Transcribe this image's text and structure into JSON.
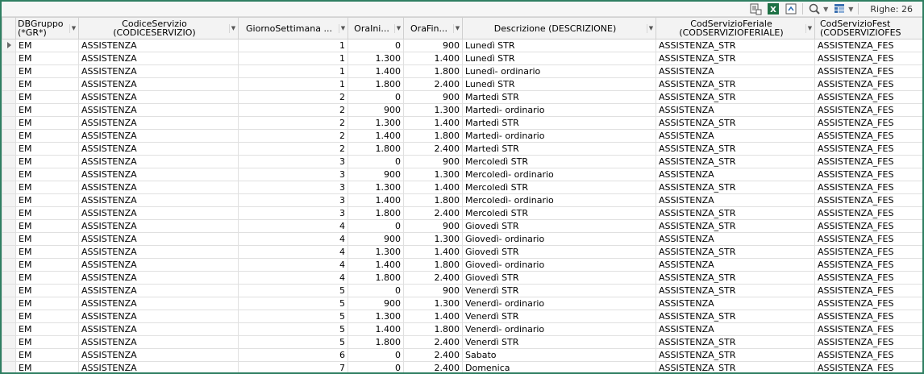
{
  "toolbar": {
    "rows_label": "Righe: 26",
    "icons": [
      "export-icon",
      "excel-icon",
      "refresh-icon",
      "search-icon",
      "filter-icon"
    ]
  },
  "columns": [
    "DBGruppo\n(*GR*)",
    "CodiceServizio\n(CODICESERVIZIO)",
    "GiornoSettimana ...",
    "OraIni...",
    "OraFin...",
    "Descrizione (DESCRIZIONE)",
    "CodServizioFeriale\n(CODSERVIZIOFERIALE)",
    "CodServizioFest\n(CODSERVIZIOFES"
  ],
  "rows": [
    [
      "EM",
      "ASSISTENZA",
      "1",
      "0",
      "900",
      "Lunedì STR",
      "ASSISTENZA_STR",
      "ASSISTENZA_FES"
    ],
    [
      "EM",
      "ASSISTENZA",
      "1",
      "1.300",
      "1.400",
      "Lunedì STR",
      "ASSISTENZA_STR",
      "ASSISTENZA_FES"
    ],
    [
      "EM",
      "ASSISTENZA",
      "1",
      "1.400",
      "1.800",
      "Lunedì- ordinario",
      "ASSISTENZA",
      "ASSISTENZA_FES"
    ],
    [
      "EM",
      "ASSISTENZA",
      "1",
      "1.800",
      "2.400",
      "Lunedì STR",
      "ASSISTENZA_STR",
      "ASSISTENZA_FES"
    ],
    [
      "EM",
      "ASSISTENZA",
      "2",
      "0",
      "900",
      "Martedì STR",
      "ASSISTENZA_STR",
      "ASSISTENZA_FES"
    ],
    [
      "EM",
      "ASSISTENZA",
      "2",
      "900",
      "1.300",
      "Martedì- ordinario",
      "ASSISTENZA",
      "ASSISTENZA_FES"
    ],
    [
      "EM",
      "ASSISTENZA",
      "2",
      "1.300",
      "1.400",
      "Martedì STR",
      "ASSISTENZA_STR",
      "ASSISTENZA_FES"
    ],
    [
      "EM",
      "ASSISTENZA",
      "2",
      "1.400",
      "1.800",
      "Martedì- ordinario",
      "ASSISTENZA",
      "ASSISTENZA_FES"
    ],
    [
      "EM",
      "ASSISTENZA",
      "2",
      "1.800",
      "2.400",
      "Martedì STR",
      "ASSISTENZA_STR",
      "ASSISTENZA_FES"
    ],
    [
      "EM",
      "ASSISTENZA",
      "3",
      "0",
      "900",
      "Mercoledì STR",
      "ASSISTENZA_STR",
      "ASSISTENZA_FES"
    ],
    [
      "EM",
      "ASSISTENZA",
      "3",
      "900",
      "1.300",
      "Mercoledì- ordinario",
      "ASSISTENZA",
      "ASSISTENZA_FES"
    ],
    [
      "EM",
      "ASSISTENZA",
      "3",
      "1.300",
      "1.400",
      "Mercoledì STR",
      "ASSISTENZA_STR",
      "ASSISTENZA_FES"
    ],
    [
      "EM",
      "ASSISTENZA",
      "3",
      "1.400",
      "1.800",
      "Mercoledì- ordinario",
      "ASSISTENZA",
      "ASSISTENZA_FES"
    ],
    [
      "EM",
      "ASSISTENZA",
      "3",
      "1.800",
      "2.400",
      "Mercoledì STR",
      "ASSISTENZA_STR",
      "ASSISTENZA_FES"
    ],
    [
      "EM",
      "ASSISTENZA",
      "4",
      "0",
      "900",
      "Giovedì STR",
      "ASSISTENZA_STR",
      "ASSISTENZA_FES"
    ],
    [
      "EM",
      "ASSISTENZA",
      "4",
      "900",
      "1.300",
      "Giovedì- ordinario",
      "ASSISTENZA",
      "ASSISTENZA_FES"
    ],
    [
      "EM",
      "ASSISTENZA",
      "4",
      "1.300",
      "1.400",
      "Giovedì STR",
      "ASSISTENZA_STR",
      "ASSISTENZA_FES"
    ],
    [
      "EM",
      "ASSISTENZA",
      "4",
      "1.400",
      "1.800",
      "Giovedì- ordinario",
      "ASSISTENZA",
      "ASSISTENZA_FES"
    ],
    [
      "EM",
      "ASSISTENZA",
      "4",
      "1.800",
      "2.400",
      "Giovedì STR",
      "ASSISTENZA_STR",
      "ASSISTENZA_FES"
    ],
    [
      "EM",
      "ASSISTENZA",
      "5",
      "0",
      "900",
      "Venerdì STR",
      "ASSISTENZA_STR",
      "ASSISTENZA_FES"
    ],
    [
      "EM",
      "ASSISTENZA",
      "5",
      "900",
      "1.300",
      "Venerdì- ordinario",
      "ASSISTENZA",
      "ASSISTENZA_FES"
    ],
    [
      "EM",
      "ASSISTENZA",
      "5",
      "1.300",
      "1.400",
      "Venerdì STR",
      "ASSISTENZA_STR",
      "ASSISTENZA_FES"
    ],
    [
      "EM",
      "ASSISTENZA",
      "5",
      "1.400",
      "1.800",
      "Venerdì- ordinario",
      "ASSISTENZA",
      "ASSISTENZA_FES"
    ],
    [
      "EM",
      "ASSISTENZA",
      "5",
      "1.800",
      "2.400",
      "Venerdì STR",
      "ASSISTENZA_STR",
      "ASSISTENZA_FES"
    ],
    [
      "EM",
      "ASSISTENZA",
      "6",
      "0",
      "2.400",
      "Sabato",
      "ASSISTENZA_STR",
      "ASSISTENZA_FES"
    ],
    [
      "EM",
      "ASSISTENZA",
      "7",
      "0",
      "2.400",
      "Domenica",
      "ASSISTENZA_STR",
      "ASSISTENZA_FES"
    ]
  ]
}
